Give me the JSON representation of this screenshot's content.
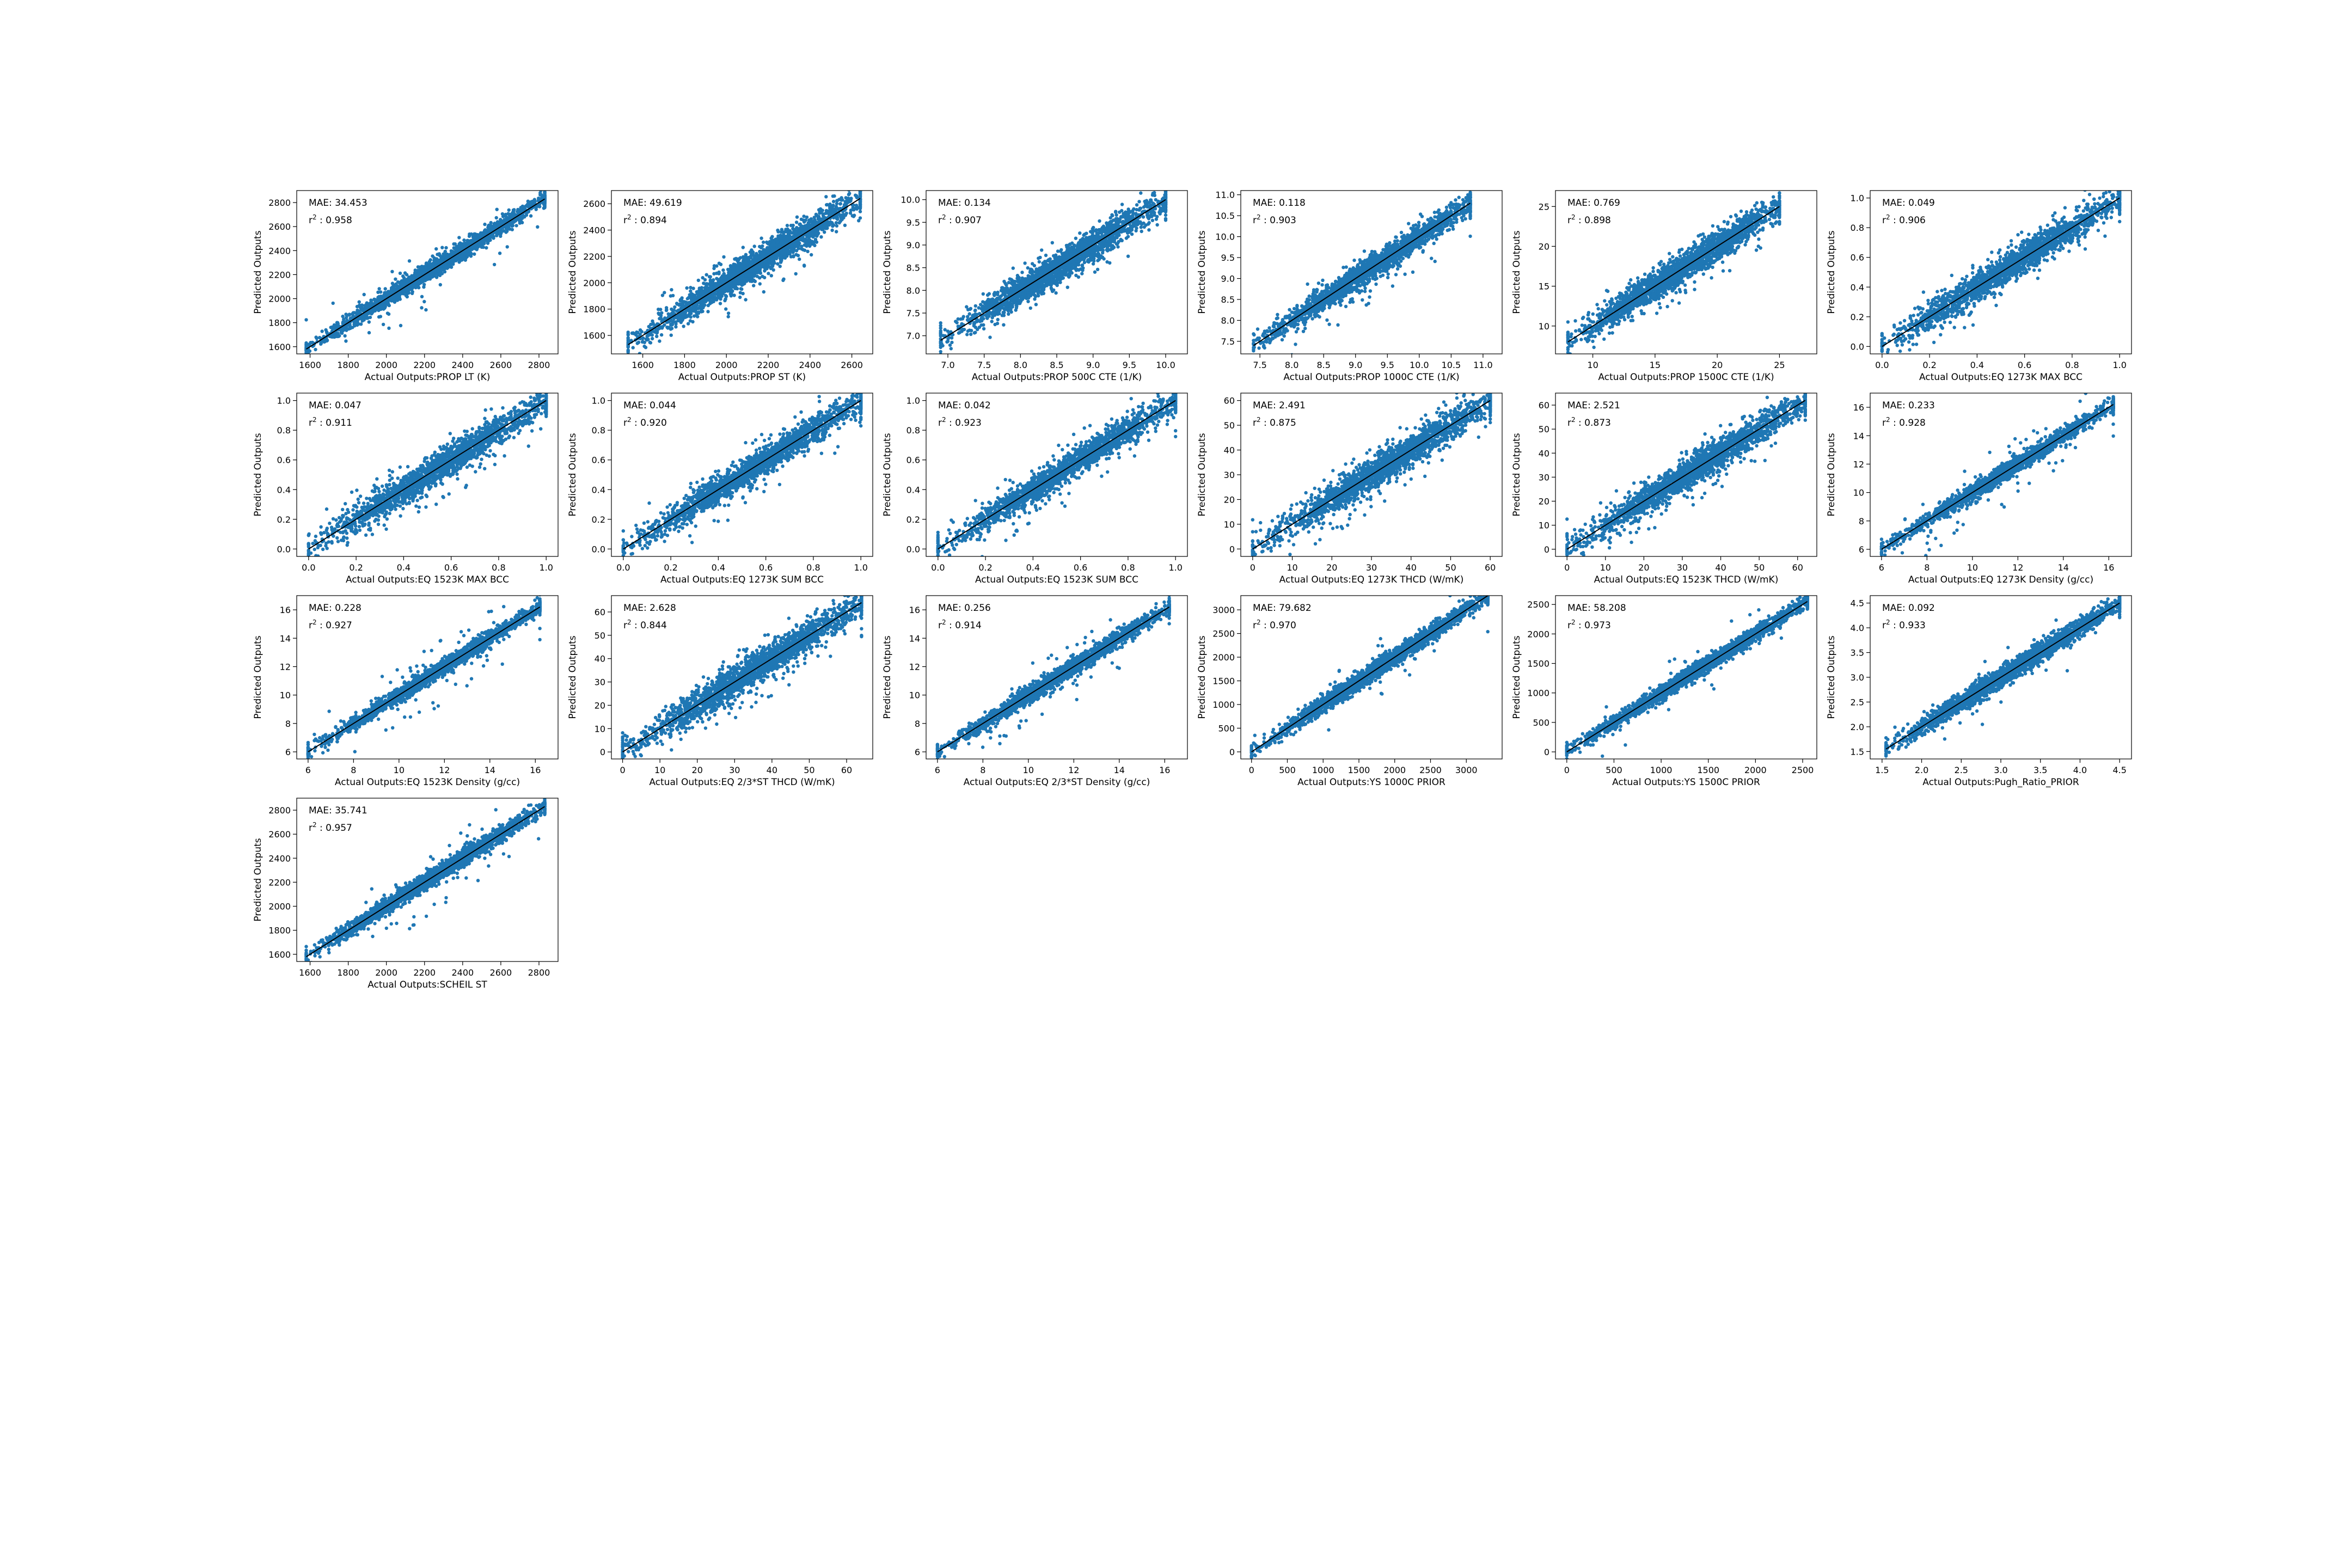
{
  "figure": {
    "y_axis_label": "Predicted Outputs",
    "point_color": "#1f77b4",
    "line_color": "#000000",
    "grid": false,
    "mae_prefix": "MAE: ",
    "r2_prefix": "r",
    "r2_sup": "2",
    "r2_mid": " : "
  },
  "chart_data": [
    {
      "type": "scatter",
      "xlabel": "Actual Outputs:PROP LT (K)",
      "ylabel": "Predicted Outputs",
      "mae": "34.453",
      "r2": "0.958",
      "xlim": [
        1530,
        2900
      ],
      "ylim": [
        1540,
        2900
      ],
      "xticks": [
        1600,
        1800,
        2000,
        2200,
        2400,
        2600,
        2800
      ],
      "yticks": [
        1600,
        1800,
        2000,
        2200,
        2400,
        2600,
        2800
      ],
      "identity_line": [
        1580,
        2830
      ],
      "n_points": 2400,
      "scatter_sd": 35,
      "outlier_fraction": 0.02
    },
    {
      "type": "scatter",
      "xlabel": "Actual Outputs:PROP ST (K)",
      "ylabel": "Predicted Outputs",
      "mae": "49.619",
      "r2": "0.894",
      "xlim": [
        1450,
        2700
      ],
      "ylim": [
        1460,
        2700
      ],
      "xticks": [
        1600,
        1800,
        2000,
        2200,
        2400,
        2600
      ],
      "yticks": [
        1600,
        1800,
        2000,
        2200,
        2400,
        2600
      ],
      "identity_line": [
        1530,
        2640
      ],
      "n_points": 2200,
      "scatter_sd": 55,
      "outlier_fraction": 0.03
    },
    {
      "type": "scatter",
      "xlabel": "Actual Outputs:PROP 500C CTE (1/K)",
      "ylabel": "Predicted Outputs",
      "mae": "0.134",
      "r2": "0.907",
      "xlim": [
        6.7,
        10.3
      ],
      "ylim": [
        6.6,
        10.2
      ],
      "xticks": [
        7.0,
        7.5,
        8.0,
        8.5,
        9.0,
        9.5,
        10.0
      ],
      "yticks": [
        7.0,
        7.5,
        8.0,
        8.5,
        9.0,
        9.5,
        10.0
      ],
      "identity_line": [
        6.9,
        10.0
      ],
      "n_points": 2200,
      "scatter_sd": 0.16,
      "outlier_fraction": 0.03
    },
    {
      "type": "scatter",
      "xlabel": "Actual Outputs:PROP 1000C CTE (1/K)",
      "ylabel": "Predicted Outputs",
      "mae": "0.118",
      "r2": "0.903",
      "xlim": [
        7.2,
        11.3
      ],
      "ylim": [
        7.2,
        11.1
      ],
      "xticks": [
        7.5,
        8.0,
        8.5,
        9.0,
        9.5,
        10.0,
        10.5,
        11.0
      ],
      "yticks": [
        7.5,
        8.0,
        8.5,
        9.0,
        9.5,
        10.0,
        10.5,
        11.0
      ],
      "identity_line": [
        7.4,
        10.8
      ],
      "n_points": 2200,
      "scatter_sd": 0.14,
      "outlier_fraction": 0.03
    },
    {
      "type": "scatter",
      "xlabel": "Actual Outputs:PROP 1500C CTE (1/K)",
      "ylabel": "Predicted Outputs",
      "mae": "0.769",
      "r2": "0.898",
      "xlim": [
        7,
        28
      ],
      "ylim": [
        6.5,
        27
      ],
      "xticks": [
        10,
        15,
        20,
        25
      ],
      "yticks": [
        10,
        15,
        20,
        25
      ],
      "identity_line": [
        8,
        25
      ],
      "n_points": 2200,
      "scatter_sd": 0.9,
      "outlier_fraction": 0.03
    },
    {
      "type": "scatter",
      "xlabel": "Actual Outputs:EQ 1273K MAX BCC",
      "ylabel": "Predicted Outputs",
      "mae": "0.049",
      "r2": "0.906",
      "xlim": [
        -0.05,
        1.05
      ],
      "ylim": [
        -0.05,
        1.05
      ],
      "xticks": [
        0.0,
        0.2,
        0.4,
        0.6,
        0.8,
        1.0
      ],
      "yticks": [
        0.0,
        0.2,
        0.4,
        0.6,
        0.8,
        1.0
      ],
      "identity_line": [
        0.0,
        1.0
      ],
      "n_points": 2000,
      "scatter_sd": 0.05,
      "outlier_fraction": 0.04
    },
    {
      "type": "scatter",
      "xlabel": "Actual Outputs:EQ 1523K MAX BCC",
      "ylabel": "Predicted Outputs",
      "mae": "0.047",
      "r2": "0.911",
      "xlim": [
        -0.05,
        1.05
      ],
      "ylim": [
        -0.05,
        1.05
      ],
      "xticks": [
        0.0,
        0.2,
        0.4,
        0.6,
        0.8,
        1.0
      ],
      "yticks": [
        0.0,
        0.2,
        0.4,
        0.6,
        0.8,
        1.0
      ],
      "identity_line": [
        0.0,
        1.0
      ],
      "n_points": 2000,
      "scatter_sd": 0.05,
      "outlier_fraction": 0.04
    },
    {
      "type": "scatter",
      "xlabel": "Actual Outputs:EQ 1273K SUM BCC",
      "ylabel": "Predicted Outputs",
      "mae": "0.044",
      "r2": "0.920",
      "xlim": [
        -0.05,
        1.05
      ],
      "ylim": [
        -0.05,
        1.05
      ],
      "xticks": [
        0.0,
        0.2,
        0.4,
        0.6,
        0.8,
        1.0
      ],
      "yticks": [
        0.0,
        0.2,
        0.4,
        0.6,
        0.8,
        1.0
      ],
      "identity_line": [
        0.0,
        1.0
      ],
      "n_points": 2000,
      "scatter_sd": 0.045,
      "outlier_fraction": 0.04
    },
    {
      "type": "scatter",
      "xlabel": "Actual Outputs:EQ 1523K SUM BCC",
      "ylabel": "Predicted Outputs",
      "mae": "0.042",
      "r2": "0.923",
      "xlim": [
        -0.05,
        1.05
      ],
      "ylim": [
        -0.05,
        1.05
      ],
      "xticks": [
        0.0,
        0.2,
        0.4,
        0.6,
        0.8,
        1.0
      ],
      "yticks": [
        0.0,
        0.2,
        0.4,
        0.6,
        0.8,
        1.0
      ],
      "identity_line": [
        0.0,
        1.0
      ],
      "n_points": 2000,
      "scatter_sd": 0.045,
      "outlier_fraction": 0.04
    },
    {
      "type": "scatter",
      "xlabel": "Actual Outputs:EQ 1273K THCD (W/mK)",
      "ylabel": "Predicted Outputs",
      "mae": "2.491",
      "r2": "0.875",
      "xlim": [
        -3,
        63
      ],
      "ylim": [
        -3,
        63
      ],
      "xticks": [
        0,
        10,
        20,
        30,
        40,
        50,
        60
      ],
      "yticks": [
        0,
        10,
        20,
        30,
        40,
        50,
        60
      ],
      "identity_line": [
        0,
        60
      ],
      "n_points": 2200,
      "scatter_sd": 3.0,
      "outlier_fraction": 0.05
    },
    {
      "type": "scatter",
      "xlabel": "Actual Outputs:EQ 1523K THCD (W/mK)",
      "ylabel": "Predicted Outputs",
      "mae": "2.521",
      "r2": "0.873",
      "xlim": [
        -3,
        65
      ],
      "ylim": [
        -3,
        65
      ],
      "xticks": [
        0,
        10,
        20,
        30,
        40,
        50,
        60
      ],
      "yticks": [
        0,
        10,
        20,
        30,
        40,
        50,
        60
      ],
      "identity_line": [
        0,
        62
      ],
      "n_points": 2200,
      "scatter_sd": 3.0,
      "outlier_fraction": 0.05
    },
    {
      "type": "scatter",
      "xlabel": "Actual Outputs:EQ 1273K Density (g/cc)",
      "ylabel": "Predicted Outputs",
      "mae": "0.233",
      "r2": "0.928",
      "xlim": [
        5.5,
        17
      ],
      "ylim": [
        5.5,
        17
      ],
      "xticks": [
        6,
        8,
        10,
        12,
        14,
        16
      ],
      "yticks": [
        6,
        8,
        10,
        12,
        14,
        16
      ],
      "identity_line": [
        6,
        16.2
      ],
      "n_points": 2000,
      "scatter_sd": 0.28,
      "outlier_fraction": 0.03
    },
    {
      "type": "scatter",
      "xlabel": "Actual Outputs:EQ 1523K Density (g/cc)",
      "ylabel": "Predicted Outputs",
      "mae": "0.228",
      "r2": "0.927",
      "xlim": [
        5.5,
        17
      ],
      "ylim": [
        5.5,
        17
      ],
      "xticks": [
        6,
        8,
        10,
        12,
        14,
        16
      ],
      "yticks": [
        6,
        8,
        10,
        12,
        14,
        16
      ],
      "identity_line": [
        6,
        16.2
      ],
      "n_points": 2000,
      "scatter_sd": 0.28,
      "outlier_fraction": 0.03
    },
    {
      "type": "scatter",
      "xlabel": "Actual Outputs:EQ 2/3*ST THCD (W/mK)",
      "ylabel": "Predicted Outputs",
      "mae": "2.628",
      "r2": "0.844",
      "xlim": [
        -3,
        67
      ],
      "ylim": [
        -3,
        67
      ],
      "xticks": [
        0,
        10,
        20,
        30,
        40,
        50,
        60
      ],
      "yticks": [
        0,
        10,
        20,
        30,
        40,
        50,
        60
      ],
      "identity_line": [
        0,
        64
      ],
      "n_points": 2200,
      "scatter_sd": 3.2,
      "outlier_fraction": 0.05
    },
    {
      "type": "scatter",
      "xlabel": "Actual Outputs:EQ 2/3*ST Density (g/cc)",
      "ylabel": "Predicted Outputs",
      "mae": "0.256",
      "r2": "0.914",
      "xlim": [
        5.5,
        17
      ],
      "ylim": [
        5.5,
        17
      ],
      "xticks": [
        6,
        8,
        10,
        12,
        14,
        16
      ],
      "yticks": [
        6,
        8,
        10,
        12,
        14,
        16
      ],
      "identity_line": [
        6,
        16.2
      ],
      "n_points": 2000,
      "scatter_sd": 0.3,
      "outlier_fraction": 0.03
    },
    {
      "type": "scatter",
      "xlabel": "Actual Outputs:YS 1000C PRIOR",
      "ylabel": "Predicted Outputs",
      "mae": "79.682",
      "r2": "0.970",
      "xlim": [
        -150,
        3500
      ],
      "ylim": [
        -150,
        3300
      ],
      "xticks": [
        0,
        500,
        1000,
        1500,
        2000,
        2500,
        3000
      ],
      "yticks": [
        0,
        500,
        1000,
        1500,
        2000,
        2500,
        3000
      ],
      "identity_line": [
        0,
        3300
      ],
      "n_points": 2400,
      "scatter_sd": 90,
      "outlier_fraction": 0.01
    },
    {
      "type": "scatter",
      "xlabel": "Actual Outputs:YS 1500C PRIOR",
      "ylabel": "Predicted Outputs",
      "mae": "58.208",
      "r2": "0.973",
      "xlim": [
        -120,
        2650
      ],
      "ylim": [
        -120,
        2650
      ],
      "xticks": [
        0,
        500,
        1000,
        1500,
        2000,
        2500
      ],
      "yticks": [
        0,
        500,
        1000,
        1500,
        2000,
        2500
      ],
      "identity_line": [
        0,
        2550
      ],
      "n_points": 2400,
      "scatter_sd": 65,
      "outlier_fraction": 0.01
    },
    {
      "type": "scatter",
      "xlabel": "Actual Outputs:Pugh_Ratio_PRIOR",
      "ylabel": "Predicted Outputs",
      "mae": "0.092",
      "r2": "0.933",
      "xlim": [
        1.35,
        4.65
      ],
      "ylim": [
        1.35,
        4.65
      ],
      "xticks": [
        1.5,
        2.0,
        2.5,
        3.0,
        3.5,
        4.0,
        4.5
      ],
      "yticks": [
        1.5,
        2.0,
        2.5,
        3.0,
        3.5,
        4.0,
        4.5
      ],
      "identity_line": [
        1.55,
        4.5
      ],
      "n_points": 2400,
      "scatter_sd": 0.1,
      "outlier_fraction": 0.01
    },
    {
      "type": "scatter",
      "xlabel": "Actual Outputs:SCHEIL ST",
      "ylabel": "Predicted Outputs",
      "mae": "35.741",
      "r2": "0.957",
      "xlim": [
        1530,
        2900
      ],
      "ylim": [
        1540,
        2900
      ],
      "xticks": [
        1600,
        1800,
        2000,
        2200,
        2400,
        2600,
        2800
      ],
      "yticks": [
        1600,
        1800,
        2000,
        2200,
        2400,
        2600,
        2800
      ],
      "identity_line": [
        1580,
        2830
      ],
      "n_points": 2400,
      "scatter_sd": 35,
      "outlier_fraction": 0.02
    }
  ]
}
